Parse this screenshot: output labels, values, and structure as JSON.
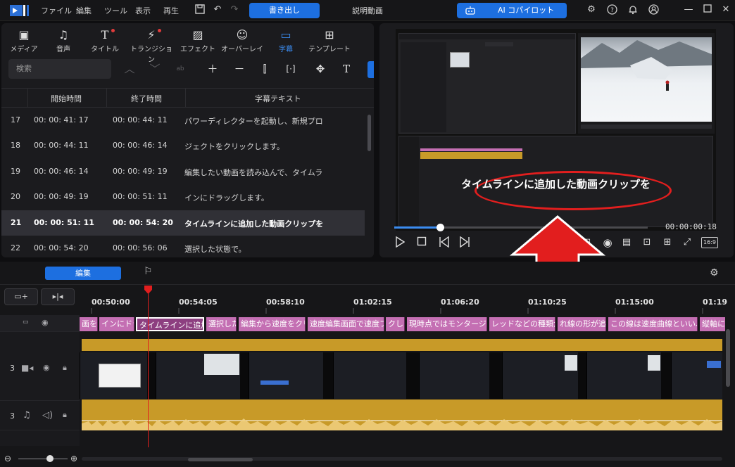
{
  "titlebar": {
    "menu": [
      "ファイル",
      "編集",
      "ツール",
      "表示",
      "再生"
    ],
    "export_label": "書き出し",
    "project_title": "説明動画",
    "copilot_label": "AI コパイロット"
  },
  "rooms": [
    {
      "label": "メディア",
      "icon": "media-icon"
    },
    {
      "label": "音声",
      "icon": "music-icon"
    },
    {
      "label": "タイトル",
      "icon": "title-icon"
    },
    {
      "label": "トランジション",
      "icon": "transition-icon"
    },
    {
      "label": "エフェクト",
      "icon": "effect-icon"
    },
    {
      "label": "オーバーレイ",
      "icon": "overlay-icon"
    },
    {
      "label": "字幕",
      "icon": "subtitle-icon"
    },
    {
      "label": "テンプレート",
      "icon": "template-icon"
    }
  ],
  "search": {
    "placeholder": "検索"
  },
  "subtitle_table": {
    "headers": {
      "start": "開始時間",
      "end": "終了時間",
      "text": "字幕テキスト"
    },
    "rows": [
      {
        "no": "17",
        "start": "00: 00: 41: 17",
        "end": "00: 00: 44: 11",
        "text": "パワーディレクターを起動し、新規プロ"
      },
      {
        "no": "18",
        "start": "00: 00: 44: 11",
        "end": "00: 00: 46: 14",
        "text": "ジェクトをクリックします。"
      },
      {
        "no": "19",
        "start": "00: 00: 46: 14",
        "end": "00: 00: 49: 19",
        "text": "編集したい動画を読み込んで、タイムラ"
      },
      {
        "no": "20",
        "start": "00: 00: 49: 19",
        "end": "00: 00: 51: 11",
        "text": "インにドラッグします。"
      },
      {
        "no": "21",
        "start": "00: 00: 51: 11",
        "end": "00: 00: 54: 20",
        "text": "タイムラインに追加した動画クリップを"
      },
      {
        "no": "22",
        "start": "00: 00: 54: 20",
        "end": "00: 00: 56: 06",
        "text": "選択した状態で。"
      }
    ]
  },
  "preview": {
    "caption": "タイムラインに追加した動画クリップを",
    "timecode": "00:00:00:18",
    "ratio": "16:9",
    "progress": 0.18
  },
  "timeline": {
    "edit_tab": "編集",
    "ruler": [
      "00:50:00",
      "00:54:05",
      "00:58:10",
      "01:02:15",
      "01:06:20",
      "01:10:25",
      "01:15:00",
      "01:19"
    ],
    "track_numbers": {
      "video": "3",
      "audio": "3"
    },
    "subtitle_clips": [
      "画を読",
      "インにドラ",
      "タイムラインに追加",
      "選択した",
      "編集から速度をクリ",
      "速度編集画面で速度フ",
      "クしま",
      "現時点ではモンタージュ、",
      "レッドなどの種類があ",
      "れ線の形が追",
      "この線は速度曲線といい、形",
      "縦軸に"
    ]
  },
  "colors": {
    "accent": "#1d6fe0",
    "subtitle_clip": "#c46fb3",
    "audio": "#c89a28",
    "highlight": "#e21e1e"
  }
}
